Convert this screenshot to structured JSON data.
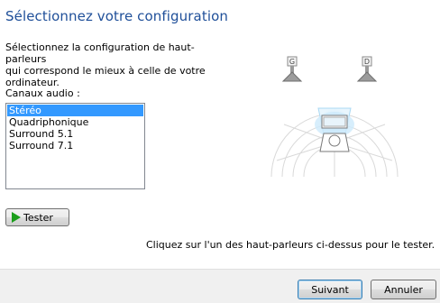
{
  "title": "Sélectionnez votre configuration",
  "description": {
    "line1": "Sélectionnez la configuration de haut-parleurs",
    "line2": "qui correspond le mieux à celle de votre",
    "line3": "ordinateur."
  },
  "channels": {
    "label": "Canaux audio :",
    "options": [
      "Stéréo",
      "Quadriphonique",
      "Surround 5.1",
      "Surround 7.1"
    ],
    "selected": "Stéréo"
  },
  "test_button": {
    "label": "Tester",
    "icon": "play-icon"
  },
  "speakers": {
    "left_label": "G",
    "right_label": "D"
  },
  "hint": "Cliquez sur l'un des haut-parleurs ci-dessus pour le tester.",
  "footer": {
    "next_label": "Suivant",
    "cancel_label": "Annuler"
  },
  "colors": {
    "title": "#1f4f99",
    "selection": "#3399ff",
    "play": "#1b9e1b"
  }
}
